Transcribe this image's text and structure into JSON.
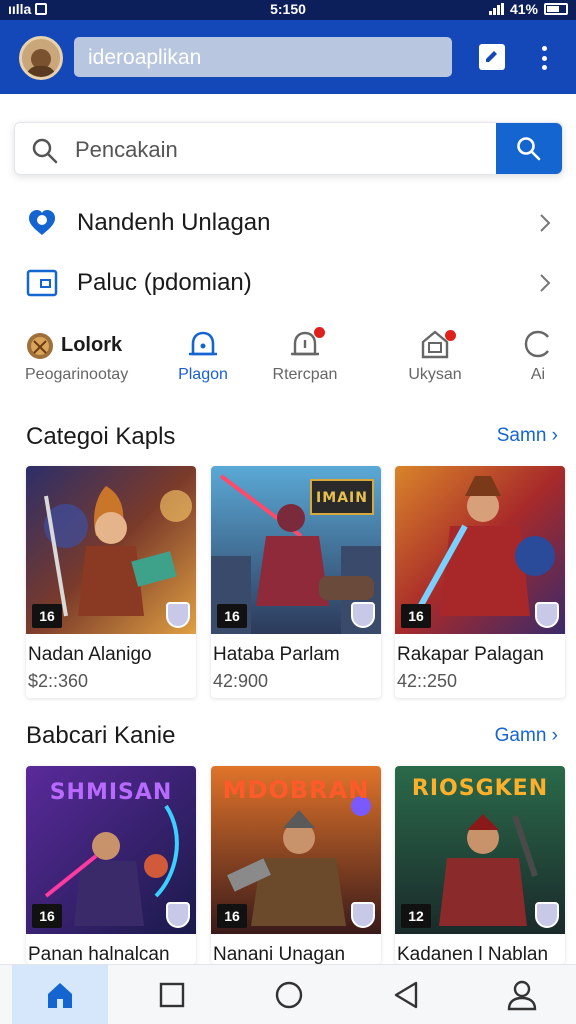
{
  "status_bar": {
    "left_text": "ıılla",
    "time": "5:150",
    "battery": "41%"
  },
  "app_bar": {
    "title_input_value": "ideroaplikan"
  },
  "search": {
    "placeholder": "Pencakain"
  },
  "menu_rows": [
    {
      "label": "Nandenh Unlagan",
      "icon": "location-heart-icon"
    },
    {
      "label": "Paluc (pdomian)",
      "icon": "wallet-icon"
    }
  ],
  "tabs": [
    {
      "title": "Lolork",
      "label": "Peogarinootay",
      "icon": "avatar-icon",
      "active": false
    },
    {
      "label": "Plagon",
      "icon": "bell-icon",
      "active": true
    },
    {
      "label": "Rtercpan",
      "icon": "bell-alert-icon",
      "active": false,
      "badge": true
    },
    {
      "label": "Ukysan",
      "icon": "home-badge-icon",
      "active": false,
      "badge": true
    },
    {
      "label": "Ai",
      "icon": "refresh-icon",
      "active": false
    }
  ],
  "section1": {
    "title": "Categoi Kapls",
    "link": "Samn",
    "cards": [
      {
        "name": "Nadan Alanigo",
        "price": "$2::360",
        "rating": "16"
      },
      {
        "name": "Hataba Parlam",
        "price": "42:900",
        "rating": "16",
        "logo": "IMAIN"
      },
      {
        "name": "Rakapar Palagan",
        "price": "42::250",
        "rating": "16"
      }
    ]
  },
  "section2": {
    "title": "Babcari Kanie",
    "link": "Gamn",
    "cards": [
      {
        "name": "Panan halnalcan",
        "rating": "16",
        "logo": "SHMISAN"
      },
      {
        "name": "Nanani Unagan",
        "rating": "16",
        "logo": "MDOBRAN"
      },
      {
        "name": "Kadanen l Nablan",
        "rating": "12",
        "logo": "RIOSGKEN"
      }
    ]
  },
  "bottom_nav": [
    {
      "icon": "home-icon",
      "active": true
    },
    {
      "icon": "square-icon",
      "active": false
    },
    {
      "icon": "circle-icon",
      "active": false
    },
    {
      "icon": "back-triangle-icon",
      "active": false
    },
    {
      "icon": "profile-icon",
      "active": false
    }
  ],
  "colors": {
    "header": "#1447b8",
    "accent": "#1565d0",
    "badge": "#e0201c"
  }
}
